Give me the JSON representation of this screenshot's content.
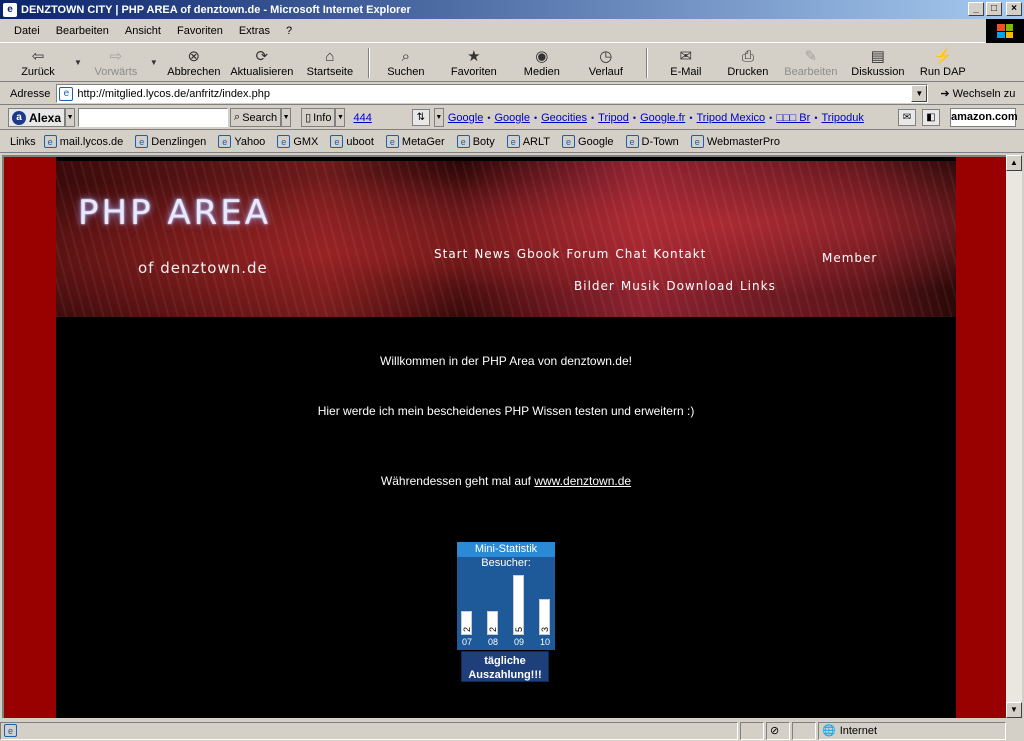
{
  "window": {
    "title": "DENZTOWN CITY | PHP AREA of denztown.de - Microsoft Internet Explorer",
    "min": "_",
    "max": "□",
    "close": "×"
  },
  "menu": [
    "Datei",
    "Bearbeiten",
    "Ansicht",
    "Favoriten",
    "Extras",
    "?"
  ],
  "toolbar": {
    "back": "Zurück",
    "forward": "Vorwärts",
    "stop": "Abbrechen",
    "refresh": "Aktualisieren",
    "home": "Startseite",
    "search": "Suchen",
    "favorites": "Favoriten",
    "media": "Medien",
    "history": "Verlauf",
    "mail": "E-Mail",
    "print": "Drucken",
    "edit": "Bearbeiten",
    "discuss": "Diskussion",
    "rundap": "Run DAP"
  },
  "address": {
    "label": "Adresse",
    "url": "http://mitglied.lycos.de/anfritz/index.php",
    "go": "Wechseln zu"
  },
  "alexa": {
    "logo": "Alexa",
    "search": "Search",
    "info": "Info",
    "count": "444",
    "links": [
      "Google",
      "Google",
      "Geocities",
      "Tripod",
      "Google.fr",
      "Tripod Mexico",
      "□□□ Br",
      "Tripoduk"
    ],
    "amazon": "amazon.com"
  },
  "links": {
    "label": "Links",
    "items": [
      "mail.lycos.de",
      "Denzlingen",
      "Yahoo",
      "GMX",
      "uboot",
      "MetaGer",
      "Boty",
      "ARLT",
      "Google",
      "D-Town",
      "WebmasterPro"
    ]
  },
  "page": {
    "banner_title": "PHP AREA",
    "banner_sub": "of denztown.de",
    "nav_row1": [
      "Start",
      "News",
      "Gbook",
      "Forum",
      "Chat",
      "Kontakt"
    ],
    "nav_row2": [
      "Bilder",
      "Musik",
      "Download",
      "Links"
    ],
    "member": "Member",
    "welcome": "Willkommen in der PHP Area von denztown.de!",
    "intro": "Hier werde ich mein bescheidenes PHP Wissen testen und erweitern :)",
    "meanwhile": "Währendessen geht mal auf ",
    "meanwhile_link": "www.denztown.de"
  },
  "stats": {
    "title": "Mini-Statistik",
    "subtitle": "Besucher:",
    "ad_line1": "tägliche",
    "ad_line2": "Auszahlung!!!"
  },
  "chart_data": {
    "type": "bar",
    "title": "Mini-Statistik",
    "ylabel": "Besucher:",
    "categories": [
      "07",
      "08",
      "09",
      "10"
    ],
    "values": [
      2,
      2,
      5,
      3
    ],
    "ylim": [
      0,
      5
    ]
  },
  "status": {
    "zone": "Internet"
  }
}
